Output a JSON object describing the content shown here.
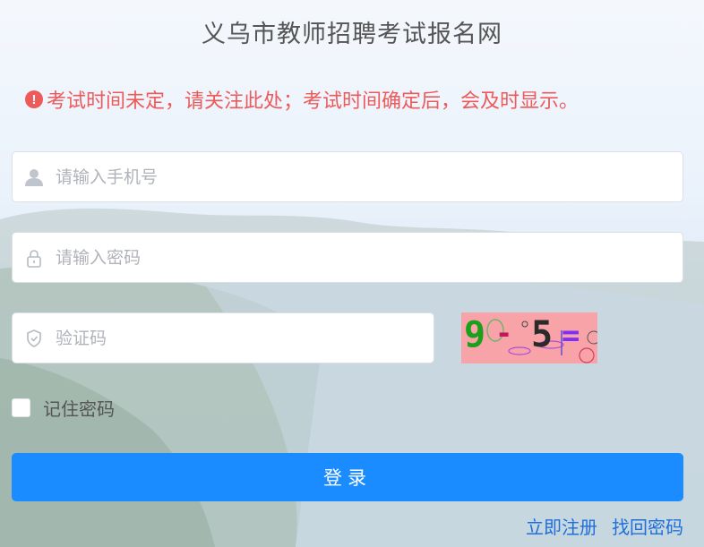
{
  "header": {
    "title": "义乌市教师招聘考试报名网"
  },
  "notice": {
    "icon": "exclamation-circle-icon",
    "text": "考试时间未定，请关注此处；考试时间确定后，会及时显示。",
    "color": "#ee5a5a"
  },
  "form": {
    "phone": {
      "placeholder": "请输入手机号",
      "value": "",
      "icon": "user-icon"
    },
    "password": {
      "placeholder": "请输入密码",
      "value": "",
      "icon": "lock-icon"
    },
    "captcha": {
      "placeholder": "验证码",
      "value": "",
      "icon": "shield-icon"
    },
    "captcha_image": {
      "text": "9-5=",
      "background": "#f8a3a8"
    },
    "remember": {
      "label": "记住密码",
      "checked": false
    },
    "login_button": "登录",
    "primary_color": "#1a8cff"
  },
  "links": {
    "register": "立即注册",
    "recover": "找回密码"
  }
}
